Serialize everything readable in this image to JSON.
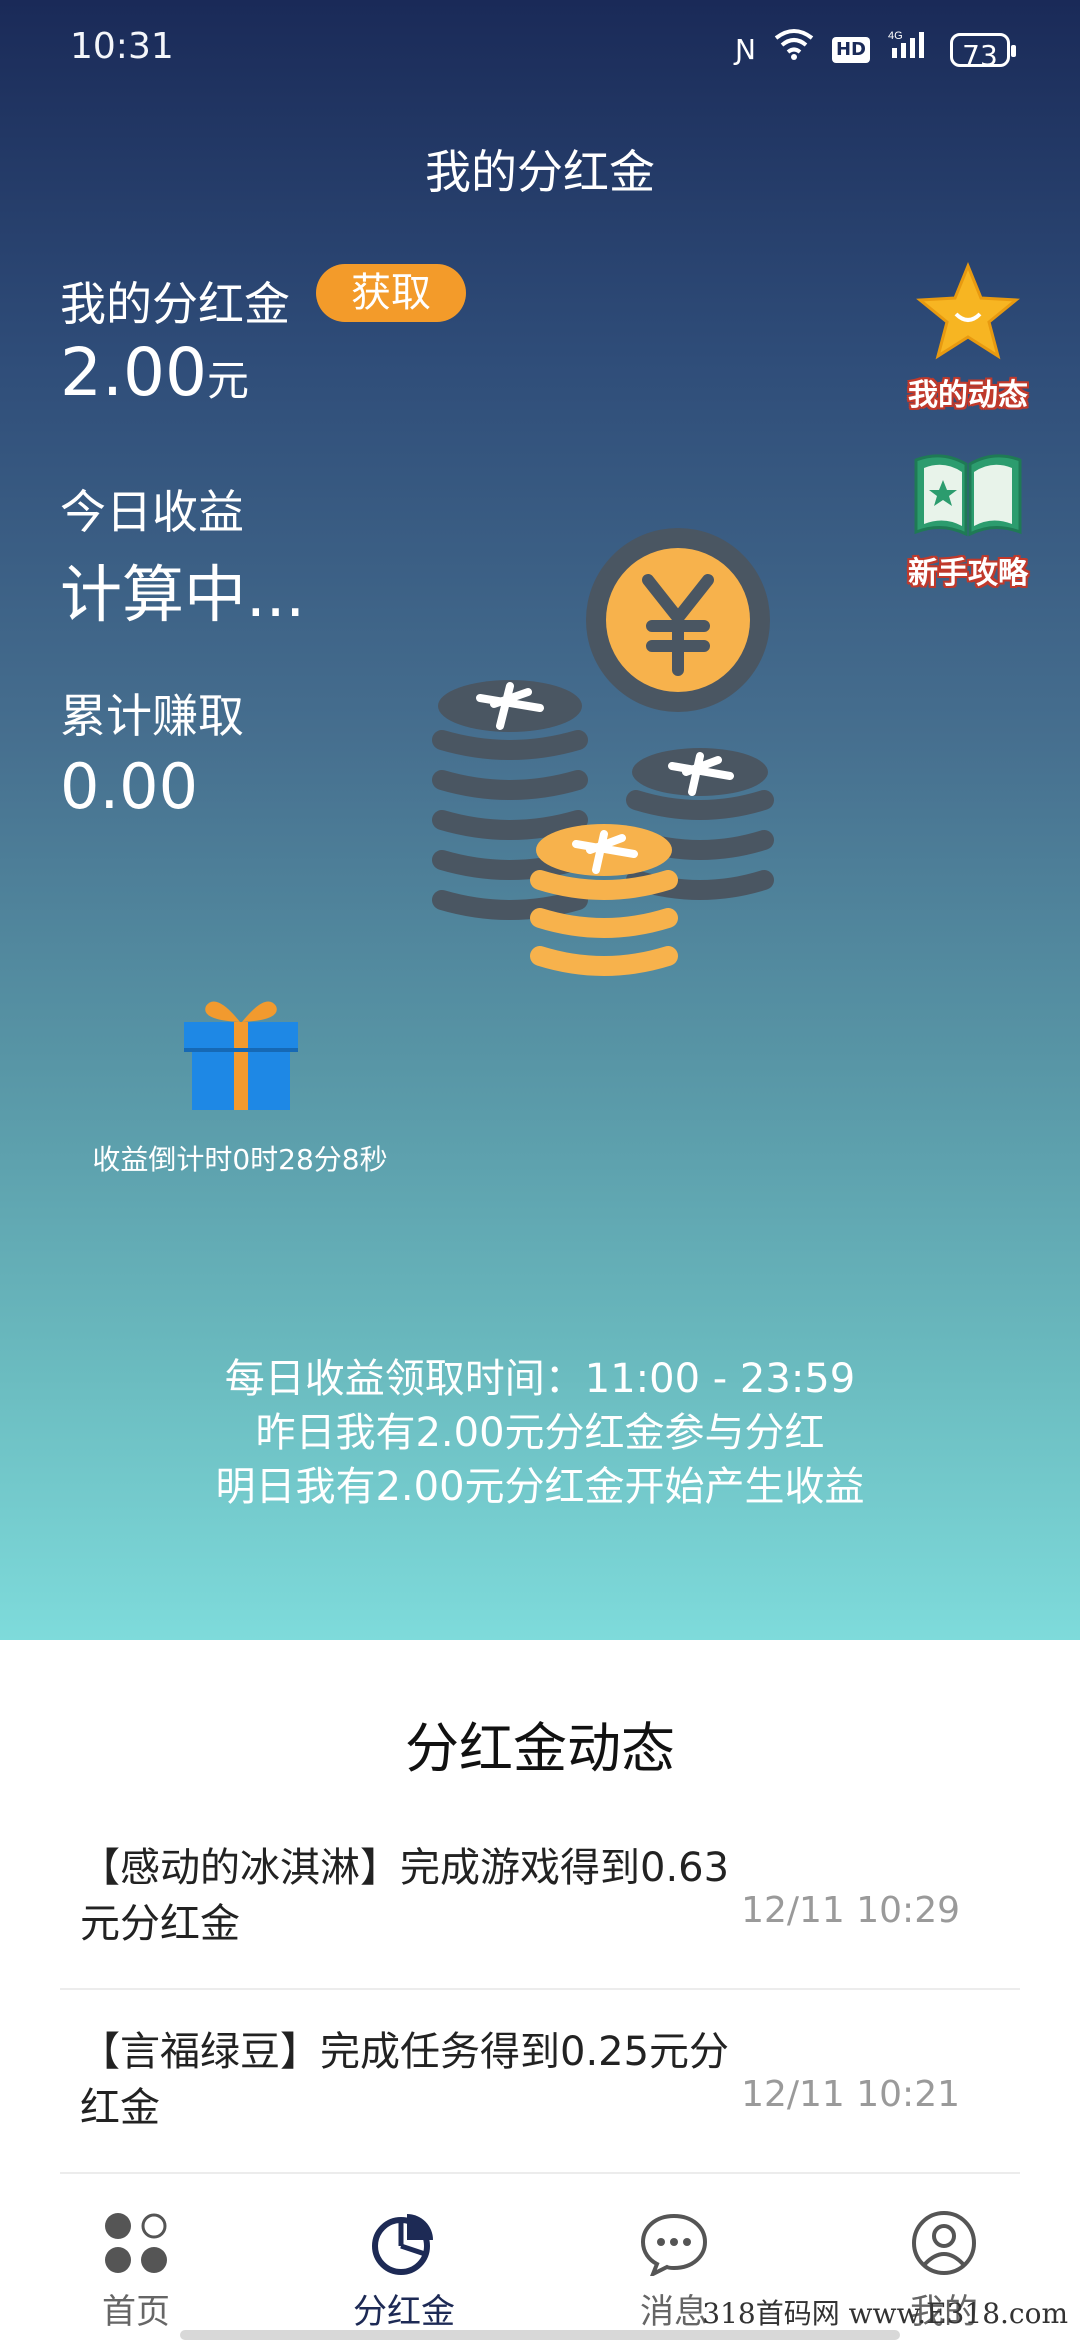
{
  "status_bar": {
    "time": "10:31",
    "battery": "73",
    "network": "4G",
    "hd": "HD"
  },
  "page": {
    "title": "我的分红金"
  },
  "balance": {
    "label": "我的分红金",
    "get_button": "获取",
    "amount": "2.00",
    "unit": "元"
  },
  "today": {
    "label": "今日收益",
    "value": "计算中..."
  },
  "total": {
    "label": "累计赚取",
    "value": "0.00"
  },
  "side_actions": [
    {
      "label": "我的动态",
      "icon": "star-face-icon"
    },
    {
      "label": "新手攻略",
      "icon": "open-book-icon"
    }
  ],
  "gift": {
    "countdown": "收益倒计时0时28分8秒"
  },
  "info": {
    "line1": "每日收益领取时间：11:00 - 23:59",
    "line2": "昨日我有2.00元分红金参与分红",
    "line3": "明日我有2.00元分红金开始产生收益"
  },
  "feed": {
    "title": "分红金动态",
    "items": [
      {
        "text": "【感动的冰淇淋】完成游戏得到0.63元分红金",
        "time": "12/11 10:29"
      },
      {
        "text": "【言福绿豆】完成任务得到0.25元分红金",
        "time": "12/11 10:21"
      }
    ]
  },
  "tabs": [
    {
      "label": "首页",
      "icon": "dots-grid-icon"
    },
    {
      "label": "分红金",
      "icon": "pie-chart-icon"
    },
    {
      "label": "消息",
      "icon": "chat-bubble-icon"
    },
    {
      "label": "我的",
      "icon": "user-circle-icon"
    }
  ],
  "watermark": "318首码网 www.E318.com",
  "colors": {
    "accent": "#f39b2a",
    "tab_active": "#1d2a55",
    "side_label_outline": "#c0392b",
    "gift_blue": "#1e88e5"
  }
}
